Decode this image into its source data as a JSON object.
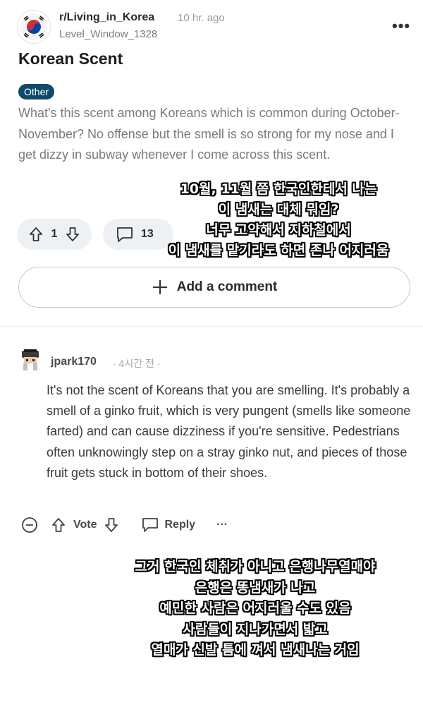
{
  "post": {
    "subreddit": "r/Living_in_Korea",
    "time": "10 hr. ago",
    "author": "Level_Window_1328",
    "title": "Korean Scent",
    "flair": "Other",
    "body": "What's this scent among Koreans which is common during October-November? No offense but the smell is so strong for my nose and I get dizzy in subway whenever I come across this scent.",
    "votes": "1",
    "comment_count": "13",
    "add_comment_label": "Add a comment"
  },
  "caption_top": [
    "10월, 11월 쯤 한국인한테서 나는",
    "이 냄새는 대체 뭐임?",
    "너무 고약해서 지하철에서",
    "이 냄새를 맡기라도 하면 존나 어지러움"
  ],
  "comment": {
    "user": "jpark170",
    "time": "· 4시간 전 ·",
    "text": "It's not the scent of Koreans that you are smelling. It's probably a smell of a ginko fruit, which is very pungent (smells like someone farted) and can cause dizziness if you're sensitive. Pedestrians often unknowingly step on a stray ginko nut, and pieces of those fruit gets stuck in bottom of their shoes.",
    "vote_label": "Vote",
    "reply_label": "Reply",
    "more_label": "···"
  },
  "caption_bottom": [
    "그거 한국인 체취가 아니고 은행나무열매야",
    "은행은 똥냄새가 나고",
    "예민한 사람은 어지러울 수도 있음",
    "사람들이 지나가면서 밟고",
    "열매가 신발 틈에 껴서 냄새나는 거임"
  ],
  "colors": {
    "flair_bg": "#0f4a6b",
    "pill_bg": "#eef1f3",
    "muted_text": "#7a7a7a"
  },
  "icons": [
    "korea-flag-icon",
    "upvote-icon",
    "downvote-icon",
    "comment-icon",
    "plus-icon",
    "collapse-icon",
    "reply-icon",
    "more-icon"
  ]
}
